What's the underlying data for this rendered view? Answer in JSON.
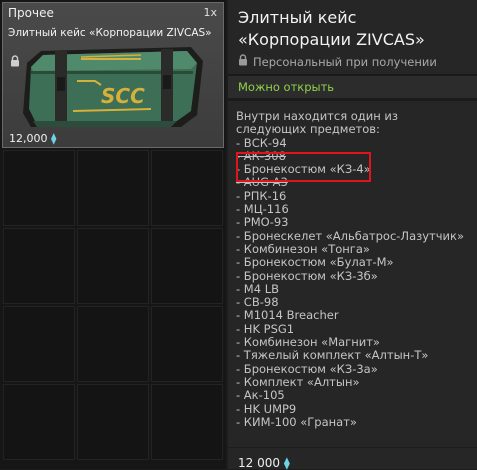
{
  "item_card": {
    "category": "Прочее",
    "quantity": "1x",
    "name": "Элитный кейс «Корпорации ZIVCAS»",
    "crate_label": "SCC",
    "price": "12,000",
    "currency_icon": "crystal-icon"
  },
  "details": {
    "title": "Элитный кейс «Корпорации ZIVCAS»",
    "binding_text": "Персональный при получении",
    "openable_text": "Можно открыть",
    "contents_intro": "Внутри находится один из следующих предметов:",
    "contents": [
      "- ВСК-94",
      "- АК-308",
      "- Бронекостюм «КЗ-4»",
      "- AUG A3",
      "- РПК-16",
      "- МЦ-116",
      "- РМО-93",
      "- Бронескелет «Альбатрос-Лазутчик»",
      "- Комбинезон «Тонга»",
      "- Бронекостюм «Булат-М»",
      "- Бронекостюм «КЗ-3б»",
      "- M4 LB",
      "- СВ-98",
      "- M1014 Breacher",
      "- HK PSG1",
      "- Комбинезон «Магнит»",
      "- Тяжелый комплект «Алтын-Т»",
      "- Бронекостюм «КЗ-3а»",
      "- Комплект «Алтын»",
      "- Ак-105",
      "- HK UMP9",
      "- КИМ-100 «Гранат»"
    ],
    "price": "12 000",
    "currency_icon": "crystal-icon"
  },
  "colors": {
    "openable": "#8fd14a",
    "highlight": "#e0141b",
    "currency": "#6fd3e6"
  }
}
